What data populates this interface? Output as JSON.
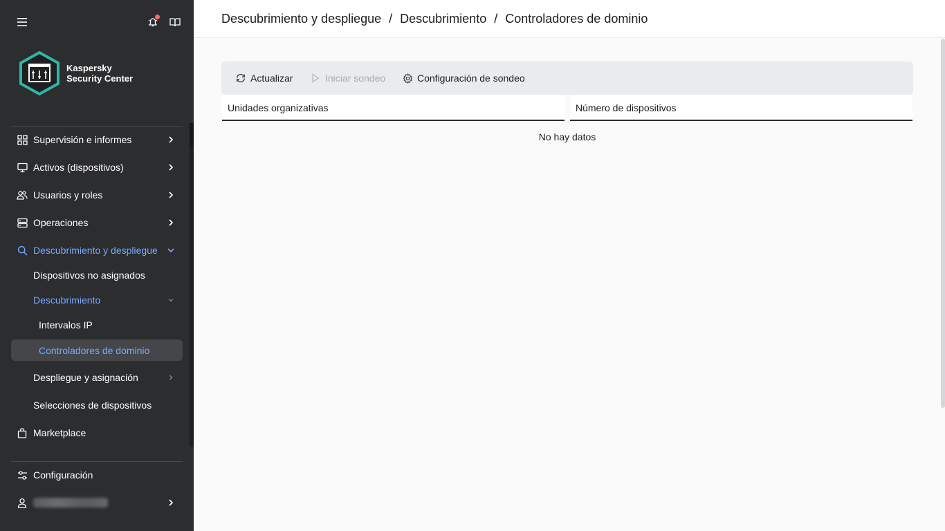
{
  "sidebar": {
    "logo": {
      "line1": "Kaspersky",
      "line2": "Security Center",
      "accent": "#2fb7a6"
    },
    "notification_dot_color": "#ff6a6a",
    "nav": [
      {
        "label": "Supervisión e informes",
        "icon": "dashboard-icon",
        "chevron": "right"
      },
      {
        "label": "Activos (dispositivos)",
        "icon": "monitor-icon",
        "chevron": "right"
      },
      {
        "label": "Usuarios y roles",
        "icon": "users-icon",
        "chevron": "right"
      },
      {
        "label": "Operaciones",
        "icon": "server-icon",
        "chevron": "right"
      },
      {
        "label": "Descubrimiento y despliegue",
        "icon": "search-icon",
        "chevron": "down"
      },
      {
        "label": "Dispositivos no asignados"
      },
      {
        "label": "Descubrimiento",
        "chevron": "down"
      },
      {
        "label": "Intervalos IP"
      },
      {
        "label": "Controladores de dominio"
      },
      {
        "label": "Despliegue y asignación",
        "chevron": "right"
      },
      {
        "label": "Selecciones de dispositivos"
      },
      {
        "label": "Marketplace",
        "icon": "bag-icon"
      }
    ],
    "settings_label": "Configuración",
    "active_color": "#7ba7ff"
  },
  "header": {
    "breadcrumb": [
      "Descubrimiento y despliegue",
      "Descubrimiento",
      "Controladores de dominio"
    ],
    "separator": "/"
  },
  "toolbar": {
    "refresh": "Actualizar",
    "start_poll": "Iniciar sondeo",
    "poll_settings": "Configuración de sondeo"
  },
  "table": {
    "columns": [
      "Unidades organizativas",
      "Número de dispositivos"
    ],
    "empty_text": "No hay datos"
  }
}
